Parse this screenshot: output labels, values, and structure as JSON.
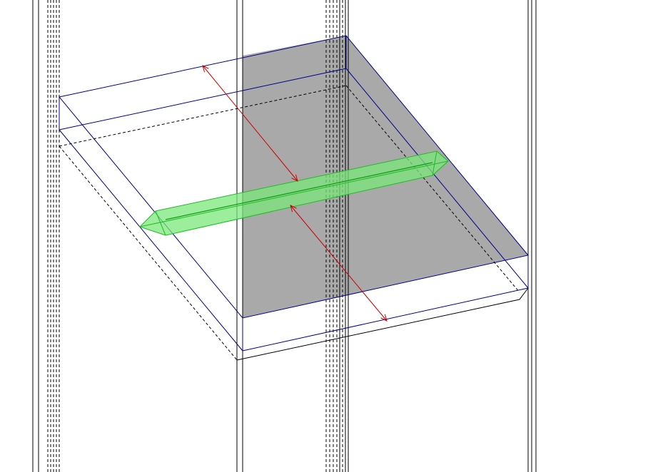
{
  "colors": {
    "background": "#ffffff",
    "column_edge": "#000000",
    "slab_edge": "#00008b",
    "section_fill": "#a9a9a9",
    "beam_fill": "#7be87b",
    "beam_edge": "#22bb22",
    "dimension": "#cc0000"
  },
  "scene": {
    "view": "3d-isometric",
    "elements": [
      "left-column",
      "middle-column",
      "right-column",
      "floor-slab",
      "section-cut-plane",
      "highlighted-beam",
      "span-dimension"
    ]
  }
}
